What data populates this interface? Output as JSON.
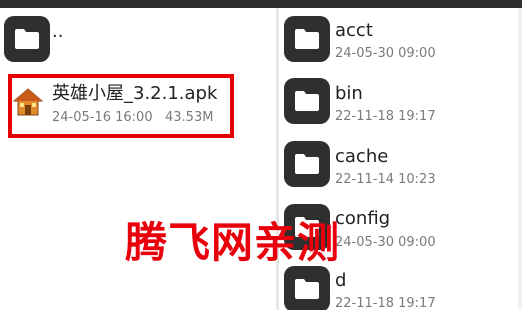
{
  "left_pane": {
    "parent_dir": {
      "name": "..",
      "icon": "folder-icon"
    },
    "selected_file": {
      "name": "英雄小屋_3.2.1.apk",
      "date": "24-05-16 16:00",
      "size": "43.53M",
      "icon": "apk-house-icon"
    }
  },
  "right_pane": {
    "items": [
      {
        "name": "acct",
        "date": "24-05-30 09:00",
        "icon": "folder-icon"
      },
      {
        "name": "bin",
        "date": "22-11-18 19:17",
        "icon": "folder-icon"
      },
      {
        "name": "cache",
        "date": "22-11-14 10:23",
        "icon": "folder-icon"
      },
      {
        "name": "config",
        "date": "24-05-30 09:00",
        "icon": "folder-icon"
      },
      {
        "name": "d",
        "date": "22-11-18 19:17",
        "icon": "folder-icon"
      }
    ]
  },
  "watermark": {
    "text": "腾飞网亲测"
  },
  "colors": {
    "highlight": "#e60000",
    "folder_bg": "#2f2f2f",
    "watermark": "#e8000b"
  }
}
